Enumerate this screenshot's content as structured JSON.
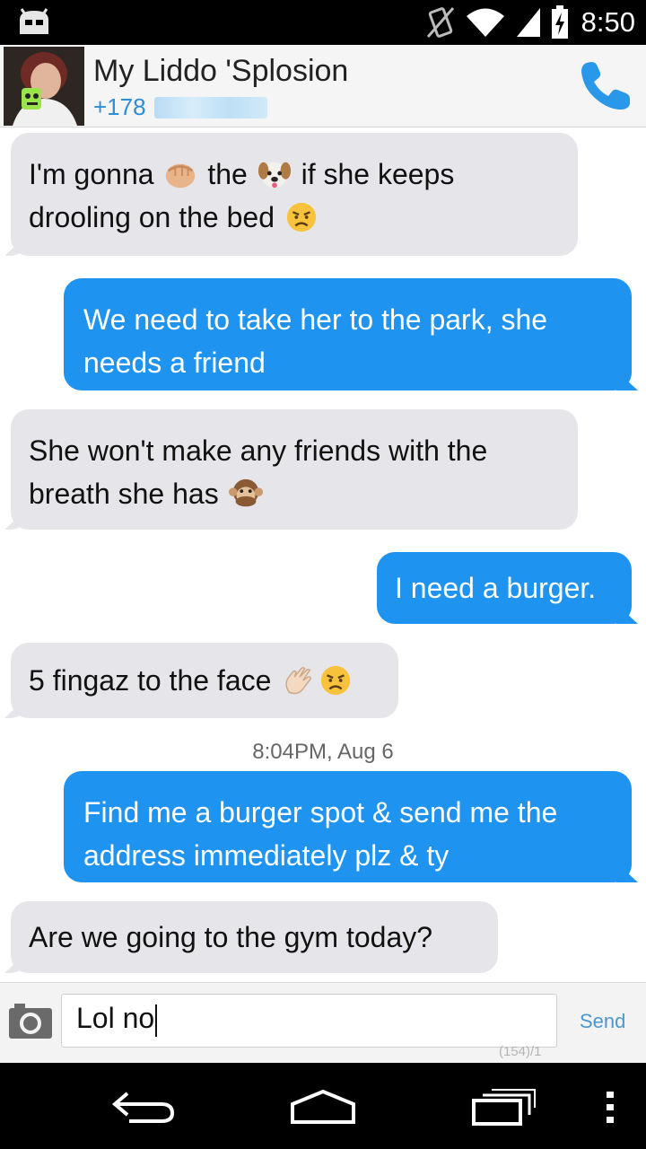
{
  "status_bar": {
    "time": "8:50",
    "icons": [
      "android-icon",
      "no-vibrate-icon",
      "wifi-icon",
      "signal-icon",
      "battery-charging-icon"
    ]
  },
  "header": {
    "contact_name": "My Liddo 'Splosion",
    "contact_number_visible": "+178",
    "call_icon": "phone-icon"
  },
  "messages": [
    {
      "direction": "in",
      "parts": [
        {
          "type": "text",
          "value": "I'm gonna "
        },
        {
          "type": "emoji",
          "value": "fist-emoji"
        },
        {
          "type": "text",
          "value": " the "
        },
        {
          "type": "emoji",
          "value": "dog-emoji"
        },
        {
          "type": "text",
          "value": " if she keeps drooling on the bed "
        },
        {
          "type": "emoji",
          "value": "angry-face-emoji"
        }
      ]
    },
    {
      "direction": "out",
      "text": "We need to take her to the park, she needs a friend"
    },
    {
      "direction": "in",
      "parts": [
        {
          "type": "text",
          "value": "She won't make any friends with the breath she has "
        },
        {
          "type": "emoji",
          "value": "speak-no-evil-monkey-emoji"
        }
      ]
    },
    {
      "direction": "out",
      "text": "I need a burger."
    },
    {
      "direction": "in",
      "parts": [
        {
          "type": "text",
          "value": "5 fingaz to the face "
        },
        {
          "type": "emoji",
          "value": "waving-hand-emoji"
        },
        {
          "type": "emoji",
          "value": "angry-face-emoji"
        }
      ]
    },
    {
      "direction": "timestamp",
      "text": "8:04PM, Aug 6"
    },
    {
      "direction": "out",
      "text": "Find me a burger spot & send me the address immediately plz & ty"
    },
    {
      "direction": "in",
      "text": "Are we going to the gym today?"
    }
  ],
  "compose": {
    "value": "Lol no",
    "send_label": "Send",
    "char_count": "(154)/1",
    "camera_icon": "camera-icon"
  },
  "nav": {
    "back_icon": "back-icon",
    "home_icon": "home-icon",
    "recents_icon": "recent-apps-icon",
    "menu_icon": "menu-icon"
  },
  "colors": {
    "outgoing_bubble": "#1e93f0",
    "incoming_bubble": "#e5e5ea",
    "accent": "#2b8fd6"
  }
}
